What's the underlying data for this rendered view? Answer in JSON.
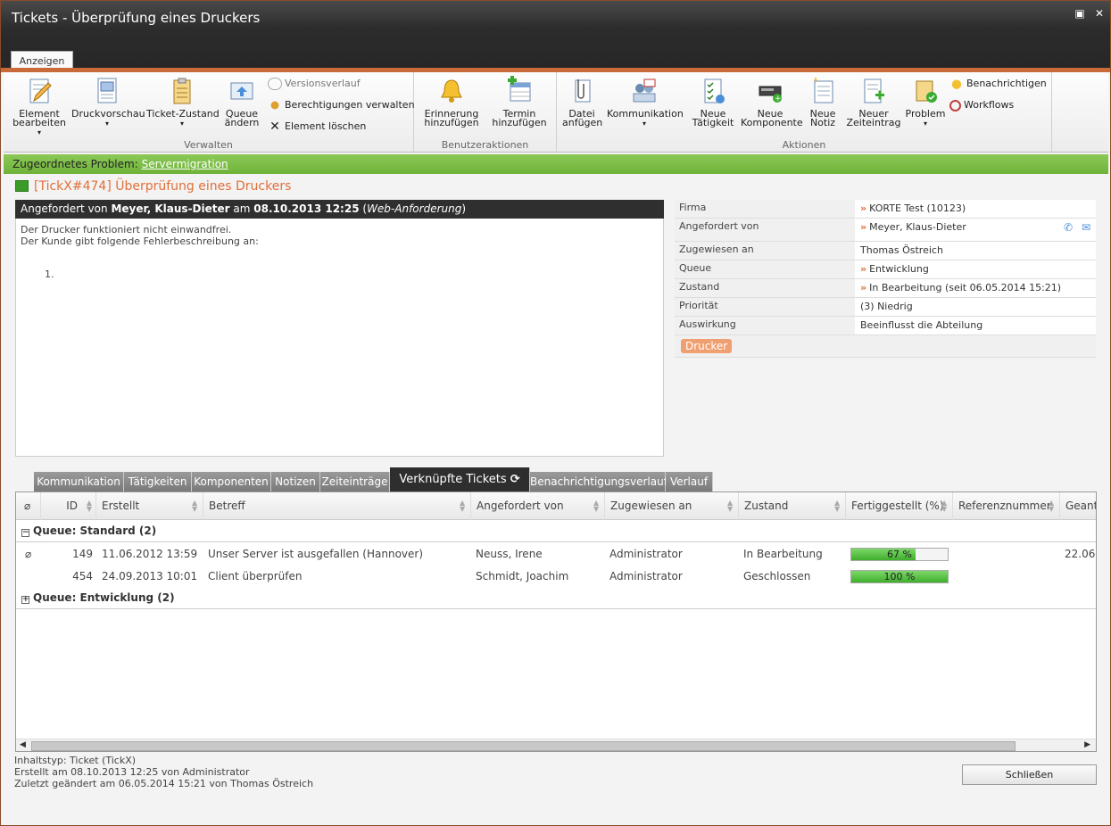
{
  "window": {
    "title": "Tickets - Überprüfung eines Druckers"
  },
  "ribbon": {
    "tab": "Anzeigen",
    "groups": {
      "verwalten": "Verwalten",
      "benutzeraktionen": "Benutzeraktionen",
      "aktionen": "Aktionen"
    },
    "buttons": {
      "element_bearbeiten": "Element bearbeiten",
      "druckvorschau": "Druckvorschau",
      "ticket_zustand": "Ticket-Zustand",
      "queue_aendern": "Queue ändern",
      "versionsverlauf": "Versionsverlauf",
      "berechtigungen": "Berechtigungen verwalten",
      "element_loeschen": "Element löschen",
      "erinnerung": "Erinnerung hinzufügen",
      "termin": "Termin hinzufügen",
      "datei": "Datei anfügen",
      "kommunikation": "Kommunikation",
      "taetigkeit": "Neue Tätigkeit",
      "komponente": "Neue Komponente",
      "notiz": "Neue Notiz",
      "zeiteintrag": "Neuer Zeiteintrag",
      "problem": "Problem",
      "benachrichtigen": "Benachrichtigen",
      "workflows": "Workflows"
    }
  },
  "parent": {
    "label": "Zugeordnetes Problem:",
    "link": "Servermigration"
  },
  "ticket": {
    "heading": "[TickX#474] Überprüfung eines Druckers",
    "req_prefix": "Angefordert von",
    "req_name": "Meyer, Klaus-Dieter",
    "req_mid": "am",
    "req_date": "08.10.2013 12:25",
    "req_via": "Web-Anforderung",
    "desc_line1": "Der Drucker funktioniert nicht einwandfrei.",
    "desc_line2": "Der Kunde gibt folgende Fehlerbeschreibung an:",
    "desc_list": "1."
  },
  "props": [
    {
      "k": "Firma",
      "v": "KORTE Test (10123)",
      "arrow": true
    },
    {
      "k": "Angefordert von",
      "v": "Meyer, Klaus-Dieter",
      "arrow": true
    },
    {
      "k": "Zugewiesen an",
      "v": "Thomas Östreich",
      "arrow": false
    },
    {
      "k": "Queue",
      "v": "Entwicklung",
      "arrow": true
    },
    {
      "k": "Zustand",
      "v": "In Bearbeitung (seit 06.05.2014 15:21)",
      "arrow": true
    },
    {
      "k": "Priorität",
      "v": "(3) Niedrig",
      "arrow": false
    },
    {
      "k": "Auswirkung",
      "v": "Beeinflusst die Abteilung",
      "arrow": false
    }
  ],
  "tag": "Drucker",
  "tabs": [
    "Kommunikation",
    "Tätigkeiten",
    "Komponenten",
    "Notizen",
    "Zeiteinträge",
    "Verknüpfte Tickets",
    "Benachrichtigungsverlauf",
    "Verlauf"
  ],
  "grid": {
    "columns": [
      "ID",
      "Erstellt",
      "Betreff",
      "Angefordert von",
      "Zugewiesen an",
      "Zustand",
      "Fertiggestellt (%)",
      "Referenznummer",
      "Geant"
    ],
    "group1": "Queue: Standard (2)",
    "group2": "Queue: Entwicklung (2)",
    "rows": [
      {
        "id": "149",
        "erstellt": "11.06.2012 13:59",
        "betreff": "Unser Server ist ausgefallen (Hannover)",
        "von": "Neuss, Irene",
        "an": "Administrator",
        "zustand": "In Bearbeitung",
        "pct": 67,
        "pct_label": "67 %",
        "geant": "22.06.",
        "attach": true
      },
      {
        "id": "454",
        "erstellt": "24.09.2013 10:01",
        "betreff": "Client überprüfen",
        "von": "Schmidt, Joachim",
        "an": "Administrator",
        "zustand": "Geschlossen",
        "pct": 100,
        "pct_label": "100 %",
        "geant": "",
        "attach": false
      }
    ]
  },
  "footer": {
    "line1": "Inhaltstyp: Ticket (TickX)",
    "line2": "Erstellt am 08.10.2013 12:25 von Administrator",
    "line3": "Zuletzt geändert am 06.05.2014 15:21 von Thomas Östreich"
  },
  "close": "Schließen"
}
